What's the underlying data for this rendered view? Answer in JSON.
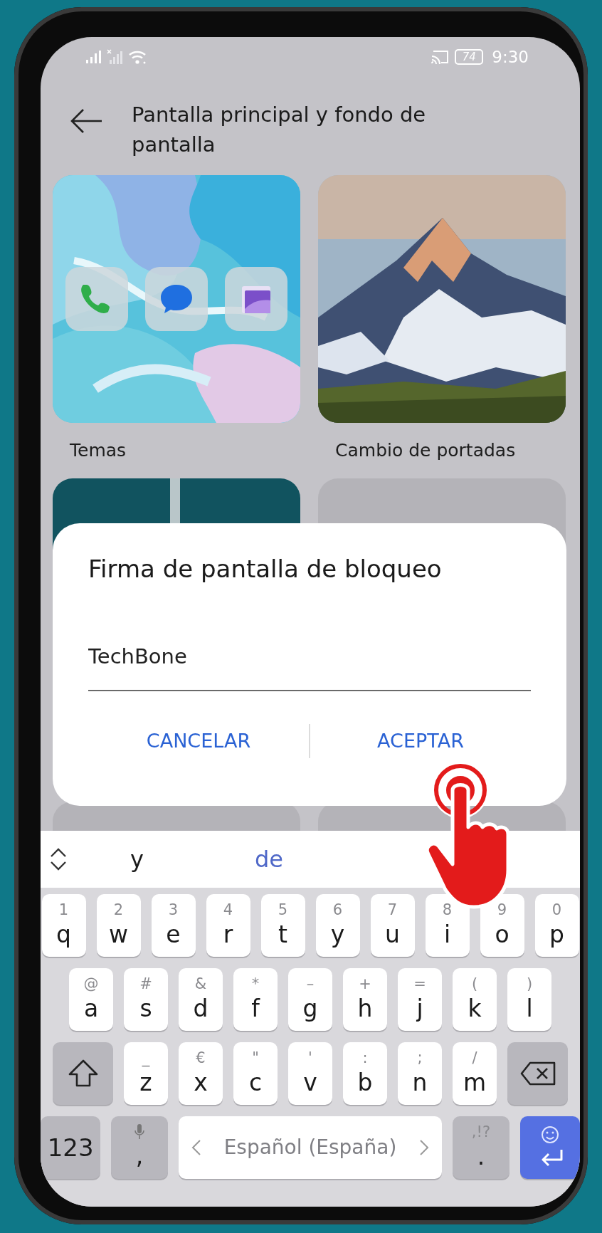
{
  "status_bar": {
    "battery": "74",
    "time": "9:30"
  },
  "header": {
    "title": "Pantalla principal y fondo de pantalla"
  },
  "tiles": [
    {
      "kind": "themes",
      "label": "Temas"
    },
    {
      "kind": "picture",
      "label": "Cambio de portadas"
    }
  ],
  "dialog": {
    "title": "Firma de pantalla de bloqueo",
    "field": {
      "value": "TechBone"
    },
    "buttons": [
      "CANCELAR",
      "ACEPTAR"
    ]
  },
  "keyboard": {
    "suggestions": [
      {
        "text": "y",
        "selected": false
      },
      {
        "text": "de",
        "selected": true
      }
    ],
    "rows": [
      [
        {
          "kind": "letter",
          "key": "q",
          "hint": "1"
        },
        {
          "kind": "letter",
          "key": "w",
          "hint": "2"
        },
        {
          "kind": "letter",
          "key": "e",
          "hint": "3"
        },
        {
          "kind": "letter",
          "key": "r",
          "hint": "4"
        },
        {
          "kind": "letter",
          "key": "t",
          "hint": "5"
        },
        {
          "kind": "letter",
          "key": "y",
          "hint": "6"
        },
        {
          "kind": "letter",
          "key": "u",
          "hint": "7"
        },
        {
          "kind": "letter",
          "key": "i",
          "hint": "8"
        },
        {
          "kind": "letter",
          "key": "o",
          "hint": "9"
        },
        {
          "kind": "letter",
          "key": "p",
          "hint": "0"
        }
      ],
      [
        {
          "kind": "letter",
          "key": "a",
          "hint": "@"
        },
        {
          "kind": "letter",
          "key": "s",
          "hint": "#"
        },
        {
          "kind": "letter",
          "key": "d",
          "hint": "&"
        },
        {
          "kind": "letter",
          "key": "f",
          "hint": "*"
        },
        {
          "kind": "letter",
          "key": "g",
          "hint": "–"
        },
        {
          "kind": "letter",
          "key": "h",
          "hint": "+"
        },
        {
          "kind": "letter",
          "key": "j",
          "hint": "="
        },
        {
          "kind": "letter",
          "key": "k",
          "hint": "("
        },
        {
          "kind": "letter",
          "key": "l",
          "hint": ")"
        }
      ],
      [
        {
          "kind": "shift"
        },
        {
          "kind": "letter",
          "key": "z",
          "hint": "_"
        },
        {
          "kind": "letter",
          "key": "x",
          "hint": "€"
        },
        {
          "kind": "letter",
          "key": "c",
          "hint": "\""
        },
        {
          "kind": "letter",
          "key": "v",
          "hint": "'"
        },
        {
          "kind": "letter",
          "key": "b",
          "hint": ":"
        },
        {
          "kind": "letter",
          "key": "n",
          "hint": ";"
        },
        {
          "kind": "letter",
          "key": "m",
          "hint": "/"
        },
        {
          "kind": "backspace"
        }
      ]
    ],
    "bottom_row": [
      {
        "kind": "numbers",
        "key": "123"
      },
      {
        "kind": "mic",
        "key": ","
      },
      {
        "kind": "space",
        "key": "Español (España)"
      },
      {
        "kind": "punct",
        "key": ".",
        "hint": ",!?"
      },
      {
        "kind": "enter"
      }
    ]
  }
}
